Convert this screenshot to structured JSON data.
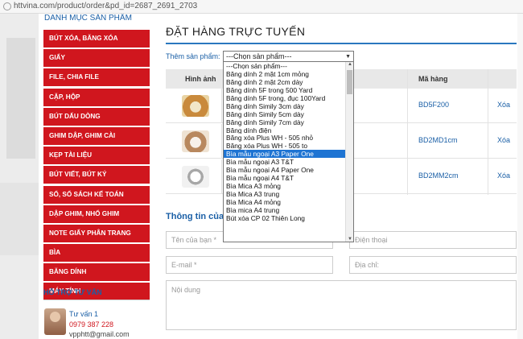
{
  "browser": {
    "url": "httvina.com/product/order&pd_id=2687_2691_2703"
  },
  "sidebar": {
    "heading": "DANH MỤC SẢN PHẨM",
    "items": [
      {
        "label": "BÚT XÓA, BĂNG XÓA"
      },
      {
        "label": "GIẤY"
      },
      {
        "label": "FILE, CHIA FILE"
      },
      {
        "label": "CẶP, HỘP"
      },
      {
        "label": "BÚT DẤU DÒNG"
      },
      {
        "label": "GHIM DẬP, GHIM CÀI"
      },
      {
        "label": "KẸP TÀI LIỆU"
      },
      {
        "label": "BÚT VIẾT, BÚT KÝ"
      },
      {
        "label": "SỔ, SỔ SÁCH KẾ TOÁN"
      },
      {
        "label": "DẬP GHIM, NHỔ GHIM"
      },
      {
        "label": "NOTE GIẤY PHÂN TRANG"
      },
      {
        "label": "BÌA"
      },
      {
        "label": "BĂNG DÍNH"
      },
      {
        "label": "MÁY TÍNH"
      }
    ],
    "support": {
      "title": "HỖ TRỢ TƯ VẤN",
      "name": "Tư vấn 1",
      "phone": "0979 387 228",
      "email": "vpphtt@gmail.com"
    }
  },
  "main": {
    "title": "ĐẶT HÀNG TRỰC TUYẾN",
    "add_product_label": "Thêm sản phẩm:",
    "select_value": "---Chọn sản phẩm---",
    "table": {
      "headers": {
        "image": "Hình ảnh",
        "code": "Mã hàng"
      },
      "rows": [
        {
          "code": "BD5F200",
          "delete": "Xóa",
          "img_color": "#c98a3c"
        },
        {
          "code": "BD2MD1cm",
          "delete": "Xóa",
          "img_color": "#b8885e"
        },
        {
          "code": "BD2MM2cm",
          "delete": "Xóa",
          "img_color": "#a7a7a7"
        }
      ]
    },
    "contact_title": "Thông tin của",
    "fields": {
      "name_placeholder": "Tên của bạn *",
      "phone_placeholder": "Điện thoại",
      "email_placeholder": "E-mail *",
      "address_placeholder": "Địa chỉ:",
      "content_placeholder": "Nội dung"
    }
  },
  "dropdown": {
    "options": [
      "---Chọn sản phẩm---",
      "Băng dính 2 mặt 1cm mỏng",
      "Băng dính 2 mặt 2cm dày",
      "Băng dính 5F trong 500 Yard",
      "Băng dính 5F trong, đục 100Yard",
      "Băng dính Simily 3cm dày",
      "Băng dính Simily 5cm dày",
      "Băng dính Simily 7cm dày",
      "Băng dính điện",
      "Băng xóa Plus WH - 505 nhỏ",
      "Băng xóa Plus WH - 505 to",
      "Bìa mẫu ngoại A3 Paper One",
      "Bìa mẫu ngoại A3 T&T",
      "Bìa mẫu ngoại A4 Paper One",
      "Bìa mẫu ngoại A4 T&T",
      "Bìa Mica A3 mỏng",
      "Bìa Mica A3 trung",
      "Bìa Mica A4 mỏng",
      "Bìa mica A4 trung",
      "Bút xóa CP 02 Thiên Long"
    ],
    "selected_index": 11
  },
  "colors": {
    "menu_red": "#d0161e",
    "accent_blue": "#1a5fa6",
    "selection_blue": "#1e74d3"
  }
}
